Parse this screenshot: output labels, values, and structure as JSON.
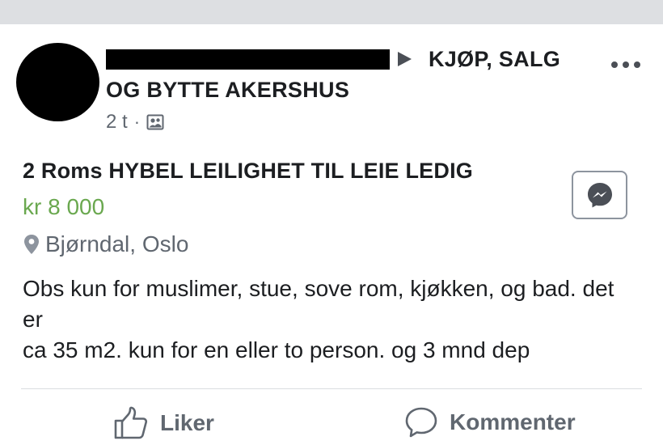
{
  "post": {
    "group_name_part1": "KJØP, SALG",
    "group_name_part2": "OG BYTTE AKERSHUS",
    "time": "2 t",
    "meta_separator": "·"
  },
  "listing": {
    "title": "2 Roms HYBEL LEILIGHET TIL LEIE LEDIG",
    "price": "kr 8 000",
    "location": "Bjørndal, Oslo",
    "description": "Obs kun for muslimer, stue, sove rom, kjøkken, og bad. det er\nca 35 m2. kun for en eller  to person. og 3 mnd dep"
  },
  "actions": {
    "like_label": "Liker",
    "comment_label": "Kommenter"
  },
  "colors": {
    "price": "#6aa84f",
    "secondary_text": "#606770",
    "top_bar": "#dddfe2"
  },
  "icons": {
    "more": "more-icon",
    "group": "group-icon",
    "location": "map-pin-icon",
    "messenger": "messenger-icon",
    "like": "thumbs-up-icon",
    "comment": "comment-icon"
  }
}
